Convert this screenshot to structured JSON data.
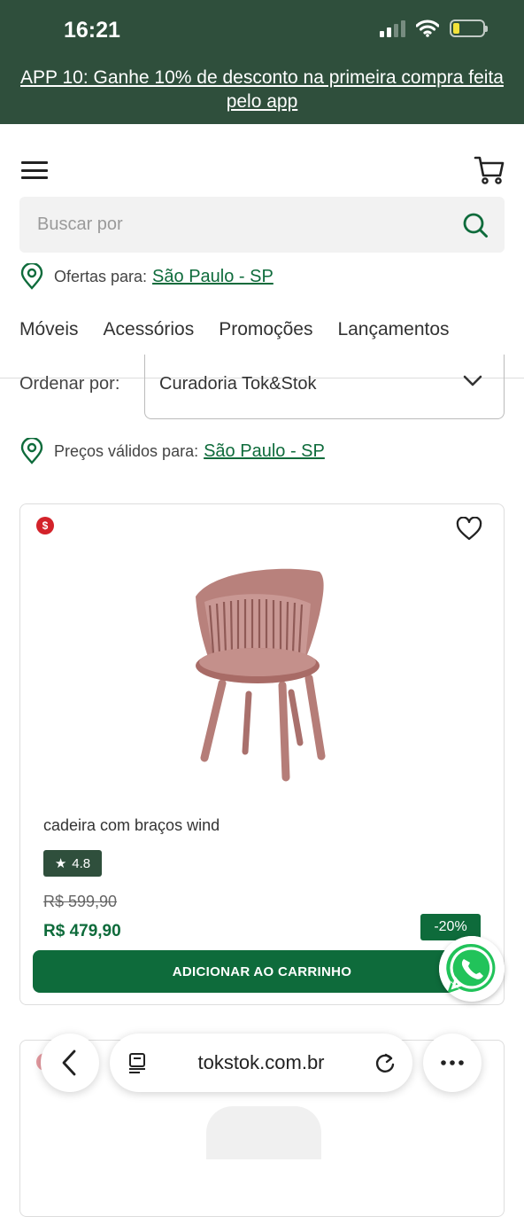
{
  "status_bar": {
    "time": "16:21"
  },
  "promo_banner": {
    "text": "APP 10: Ganhe 10% de desconto na primeira compra feita pelo app"
  },
  "search": {
    "placeholder": "Buscar por"
  },
  "offers_location": {
    "label": "Ofertas para:",
    "value": "São Paulo - SP"
  },
  "nav": {
    "items": [
      "Móveis",
      "Acessórios",
      "Promoções",
      "Lançamentos"
    ]
  },
  "sort": {
    "label": "Ordenar por:",
    "selected": "Curadoria Tok&Stok"
  },
  "prices_location": {
    "label": "Preços válidos para:",
    "value": "São Paulo - SP"
  },
  "product": {
    "badge": "$",
    "name": "cadeira com braços wind",
    "rating": "4.8",
    "rating_star": "★",
    "old_price": "R$ 599,90",
    "price": "R$ 479,90",
    "discount": "-20%",
    "add_to_cart": "ADICIONAR AO CARRINHO"
  },
  "browser": {
    "url": "tokstok.com.br"
  },
  "colors": {
    "brand_green": "#0e6b3b",
    "header_green": "#2f4f3c",
    "sale_red": "#d3222a"
  }
}
